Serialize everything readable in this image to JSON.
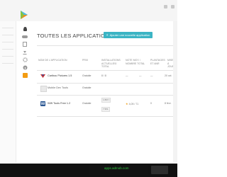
{
  "header": {
    "title": "TOUTES LES APPLICATIONS",
    "add_button_label": "Ajouter une nouvelle application"
  },
  "table": {
    "columns": [
      "NOM DE L'APPLICATION",
      "PRIX",
      "INSTALLATIONS ACTUELLES/ TOTAL",
      "NOTE MOY. / NOMBRE TOTAL",
      "PLANTAGES ET ANR",
      "MISE À JOUR"
    ],
    "rows": [
      {
        "name": "Caribou Pictures 1.5",
        "price": "Gratuite",
        "installs": "8 / 8",
        "rating": "—",
        "rating_count": "—",
        "crashes": "—",
        "updated": "20 oct. 2012"
      },
      {
        "name": "Mobile Dev Tools",
        "price": "Gratuite",
        "installs": "",
        "rating": "",
        "rating_count": "",
        "crashes": "",
        "updated": ""
      },
      {
        "name": "WW Tools Free 1.2",
        "price": "Gratuite",
        "installs": "1 897 /",
        "installs_total": "7 951",
        "rating": "4,05",
        "rating_count": "71",
        "crashes": "0",
        "updated": "8 févr. 2013"
      }
    ]
  },
  "ad": {
    "text": "apps.admob.com"
  },
  "colors": {
    "accent": "#3bb4c4",
    "ad_text": "#2ecc40"
  }
}
